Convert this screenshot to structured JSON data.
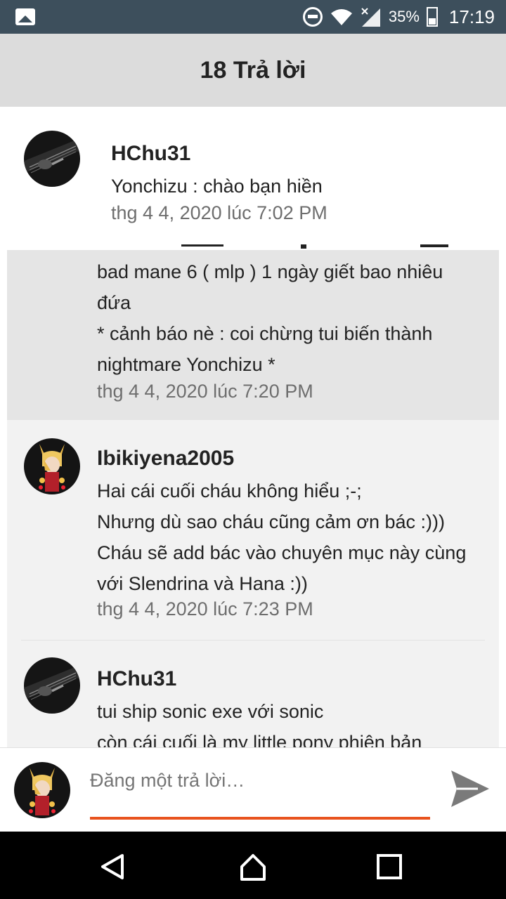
{
  "status_bar": {
    "battery": "35%",
    "time": "17:19",
    "icons": [
      "image-icon",
      "dnd-icon",
      "wifi-icon",
      "signal-icon",
      "battery-icon"
    ]
  },
  "header": {
    "title": "18 Trả lời"
  },
  "comments": [
    {
      "author": "HChu31",
      "lines": [
        "Yonchizu : chào bạn hiền"
      ],
      "time": "thg 4 4, 2020 lúc 7:02 PM"
    },
    {
      "author": "",
      "lines": [
        "bad mane 6 ( mlp ) 1 ngày giết bao nhiêu",
        "đứa",
        "* cảnh báo nè : coi chừng tui biến thành",
        "nightmare Yonchizu *"
      ],
      "time": "thg 4 4, 2020 lúc 7:20 PM"
    },
    {
      "author": "Ibikiyena2005",
      "lines": [
        "Hai cái cuối cháu không hiểu ;-;",
        "Nhưng dù sao cháu cũng cảm ơn bác :)))",
        "Cháu sẽ add bác vào chuyên mục này cùng",
        "với Slendrina và Hana :))"
      ],
      "time": "thg 4 4, 2020 lúc 7:23 PM"
    },
    {
      "author": "HChu31",
      "lines": [
        "tui ship sonic exe với sonic",
        "còn cái cuối là my little pony phiên bản"
      ],
      "time": ""
    }
  ],
  "reply": {
    "placeholder": "Đăng một trả lời…"
  },
  "colors": {
    "accent": "#e8531e",
    "status_bar": "#3d4f5c",
    "header_bg": "#dcdcdc",
    "highlight_bg": "#e5e5e5",
    "panel_bg": "#f2f2f2"
  }
}
